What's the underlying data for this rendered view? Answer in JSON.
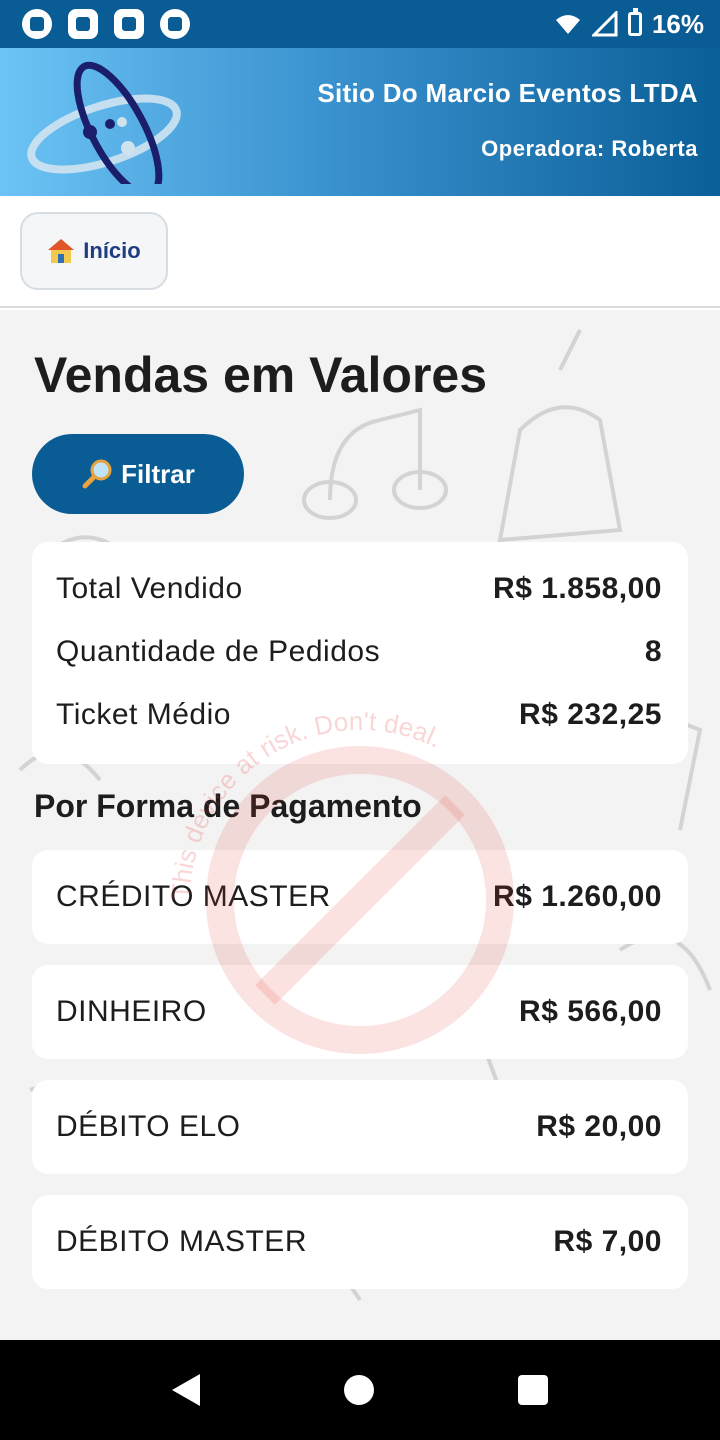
{
  "status_bar": {
    "battery": "16%",
    "icons": [
      "app-notification-icon",
      "cast-icon",
      "grid-app-icon",
      "app-notification-icon",
      "wifi-icon",
      "signal-icon",
      "battery-charging-icon"
    ]
  },
  "header": {
    "company_name": "Sitio Do Marcio Eventos LTDA",
    "operator": "Operadora: Roberta"
  },
  "nav": {
    "home_label": "Início"
  },
  "main": {
    "title": "Vendas em Valores",
    "filter_label": "Filtrar",
    "summary": [
      {
        "label": "Total Vendido",
        "value": "R$ 1.858,00"
      },
      {
        "label": "Quantidade de Pedidos",
        "value": "8"
      },
      {
        "label": "Ticket Médio",
        "value": "R$ 232,25"
      }
    ],
    "payment_section_title": "Por Forma de Pagamento",
    "payments": [
      {
        "label": "CRÉDITO MASTER",
        "value": "R$ 1.260,00"
      },
      {
        "label": "DINHEIRO",
        "value": "R$ 566,00"
      },
      {
        "label": "DÉBITO ELO",
        "value": "R$ 20,00"
      },
      {
        "label": "DÉBITO MASTER",
        "value": "R$ 7,00"
      }
    ]
  },
  "watermark": {
    "text": "This device at risk. Don't deal."
  },
  "colors": {
    "primary": "#0a5c95",
    "header_gradient_start": "#6cc3f5",
    "header_gradient_end": "#0b5f98",
    "watermark": "#e53935"
  }
}
